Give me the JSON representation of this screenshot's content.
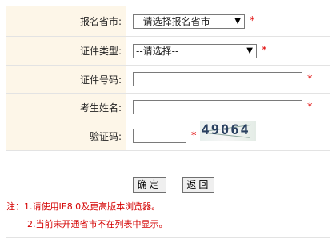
{
  "form": {
    "province_label": "报名省市:",
    "province_value": "--请选择报名省市--",
    "id_type_label": "证件类型:",
    "id_type_value": "--请选择--",
    "id_number_label": "证件号码:",
    "id_number_value": "",
    "name_label": "考生姓名:",
    "name_value": "",
    "captcha_label": "验证码:",
    "captcha_value": "",
    "captcha_image_text": "49064",
    "required_mark": "*"
  },
  "buttons": {
    "confirm": "确定",
    "back": "返回"
  },
  "notes": {
    "line1": "注：1.请使用IE8.0及更高版本浏览器。",
    "line2": "2.当前未开通省市不在列表中显示。"
  },
  "colors": {
    "label_bg": "#fdf6e8",
    "required": "#e00000",
    "note_text": "#d40000",
    "border": "#e3e3e3"
  }
}
